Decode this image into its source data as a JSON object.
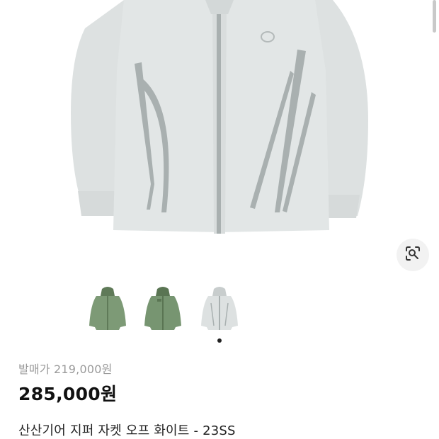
{
  "product": {
    "original_price": "발매가 219,000원",
    "price": "285,000원",
    "title": "산산기어 지퍼 자켓 오프 화이트 - 23SS"
  },
  "gallery": {
    "thumbnails": [
      {
        "color_name": "green-jacket-icon",
        "color": "#7d9a76"
      },
      {
        "color_name": "green-jacket-icon",
        "color": "#7d9a76"
      },
      {
        "color_name": "white-jacket-icon",
        "color": "#dde1e1"
      }
    ],
    "selected_index": 2
  },
  "icons": {
    "lens": "lens-search-icon"
  },
  "colors": {
    "jacket": "#dfe3e3",
    "zipper": "#a9b0b0",
    "text_primary": "#111111",
    "text_muted": "#9a9a9a"
  }
}
